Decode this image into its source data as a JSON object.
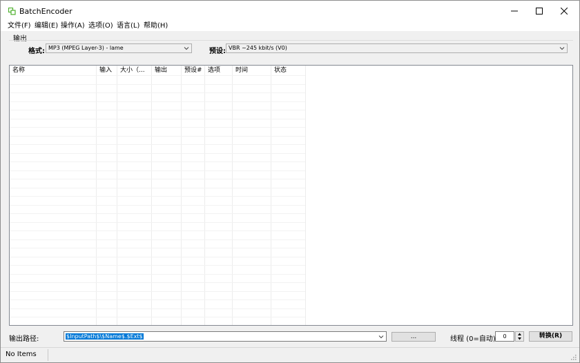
{
  "window": {
    "title": "BatchEncoder"
  },
  "menu": {
    "items": [
      {
        "label": "文件(F)"
      },
      {
        "label": "编辑(E)"
      },
      {
        "label": "操作(A)"
      },
      {
        "label": "选项(O)"
      },
      {
        "label": "语言(L)"
      },
      {
        "label": "帮助(H)"
      }
    ]
  },
  "output_group": {
    "label": "输出",
    "format_label": "格式:",
    "format_value": "MP3 (MPEG Layer-3) - lame",
    "preset_label": "预设:",
    "preset_value": "VBR ~245 kbit/s (V0)"
  },
  "list": {
    "columns": [
      "名称",
      "输入",
      "大小（...",
      "输出",
      "预设#",
      "选项",
      "时间",
      "状态"
    ]
  },
  "bottom": {
    "output_path_label": "输出路径:",
    "output_path_value": "$InputPath$\\$Name$.$Ext$",
    "browse_label": "...",
    "threads_label": "线程 (0=自动):",
    "threads_value": "0",
    "convert_label": "转换(R)"
  },
  "status": {
    "text": "No Items"
  },
  "colors": {
    "accent": "#0078d7",
    "icon_green": "#4caf2b"
  }
}
